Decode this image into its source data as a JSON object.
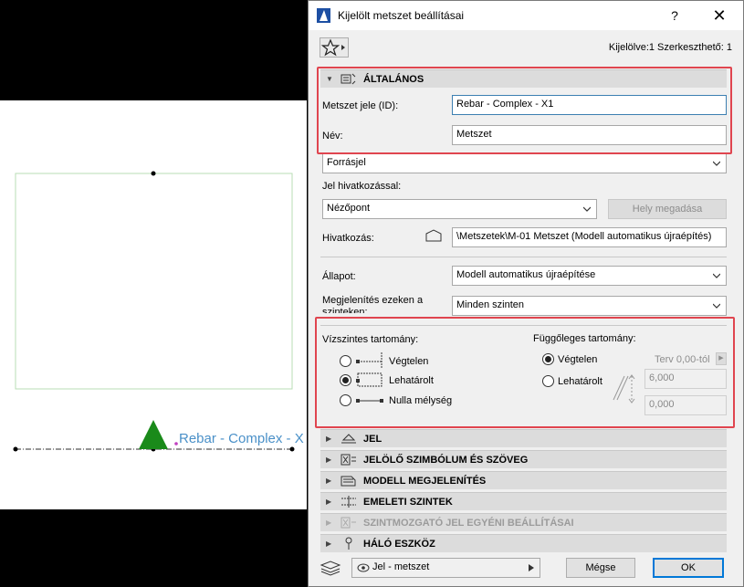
{
  "plan": {
    "section_label": "Rebar - Complex - X"
  },
  "dialog": {
    "title": "Kijelölt metszet beállításai",
    "help": "?",
    "close": "✕",
    "selected_info": "Kijelölve:1 Szerkeszthető: 1"
  },
  "general": {
    "header": "ÁLTALÁNOS",
    "id_label": "Metszet jele (ID):",
    "id_value": "Rebar - Complex - X1",
    "name_label": "Név:",
    "name_value": "Metszet",
    "source_select": "Forrásjel",
    "ref_label": "Jel hivatkozással:",
    "ref_select": "Nézőpont",
    "set_location_btn": "Hely megadása",
    "link_label": "Hivatkozás:",
    "link_value": "\\Metszetek\\M-01 Metszet (Modell automatikus újraépítés)",
    "status_label": "Állapot:",
    "status_select": "Modell automatikus újraépítése",
    "show_on_label": "Megjelenítés ezeken a szinteken:",
    "show_on_select": "Minden szinten"
  },
  "horizontal": {
    "title": "Vízszintes tartomány:",
    "options": [
      "Végtelen",
      "Lehatárolt",
      "Nulla mélység"
    ],
    "selected": 1
  },
  "vertical": {
    "title": "Függőleges tartomány:",
    "options": [
      "Végtelen",
      "Lehatárolt"
    ],
    "selected": 0,
    "from_label": "Terv 0,00-tól",
    "upper_value": "6,000",
    "lower_value": "0,000"
  },
  "sections": [
    {
      "label": "JEL"
    },
    {
      "label": "JELÖLŐ SZIMBÓLUM ÉS SZÖVEG"
    },
    {
      "label": "MODELL MEGJELENÍTÉS"
    },
    {
      "label": "EMELETI SZINTEK"
    },
    {
      "label": "SZINTMOZGATÓ JEL EGYÉNI BEÁLLÍTÁSAI"
    },
    {
      "label": "HÁLÓ ESZKÖZ"
    }
  ],
  "bottom": {
    "layer_select": "Jel - metszet",
    "cancel": "Mégse",
    "ok": "OK"
  },
  "colors": {
    "highlight": "#e0454f",
    "triangle": "#1a8a1a",
    "section_label": "#4a90c8"
  }
}
